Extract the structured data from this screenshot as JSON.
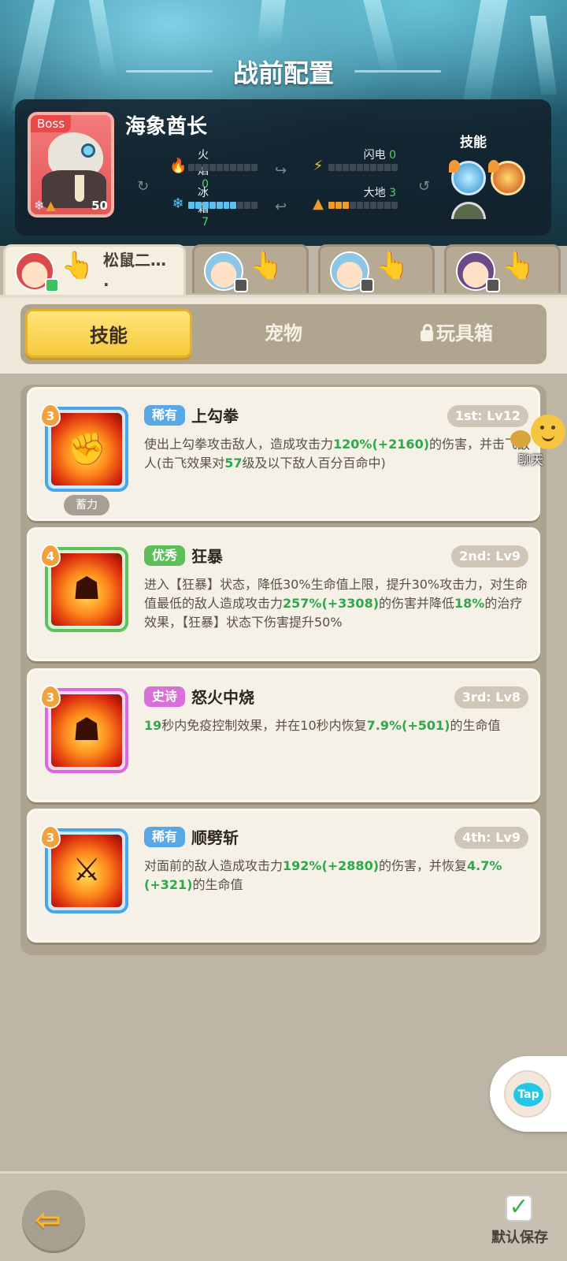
{
  "header": {
    "title": "战前配置"
  },
  "boss": {
    "tag": "Boss",
    "name": "海象酋长",
    "level": "50",
    "skills_label": "技能",
    "elements": [
      {
        "name": "火焰",
        "value": "0",
        "icon": "flame-icon",
        "color": "#ff5a3c",
        "filled": 0
      },
      {
        "name": "闪电",
        "value": "0",
        "icon": "lightning-icon",
        "color": "#f7c22a",
        "filled": 0
      },
      {
        "name": "冰霜",
        "value": "7",
        "icon": "snowflake-icon",
        "color": "#5cc1f0",
        "filled": 7
      },
      {
        "name": "大地",
        "value": "3",
        "icon": "earth-icon",
        "color": "#f09a2a",
        "filled": 3
      }
    ]
  },
  "heroes": [
    {
      "name": "松鼠二…\n.",
      "avatar": "red",
      "active": true
    },
    {
      "name": "",
      "avatar": "blue",
      "active": false
    },
    {
      "name": "",
      "avatar": "blue",
      "active": false
    },
    {
      "name": "",
      "avatar": "purple",
      "active": false
    }
  ],
  "categories": {
    "skills": "技能",
    "pets": "宠物",
    "toybox": "玩具箱"
  },
  "skills": [
    {
      "rarity": "稀有",
      "rarity_color": "#5aa7e6",
      "name": "上勾拳",
      "slot": "1st: Lv12",
      "level": "3",
      "tag": "蓄力",
      "frame": "blue",
      "desc": [
        {
          "t": "使出上勾拳攻击敌人，造成攻击力"
        },
        {
          "t": "120%(+2160)",
          "g": true
        },
        {
          "t": "的伤害，并击飞敌人(击飞效果对"
        },
        {
          "t": "57",
          "g": true
        },
        {
          "t": "级及以下敌人百分百命中)"
        }
      ]
    },
    {
      "rarity": "优秀",
      "rarity_color": "#5cbf5a",
      "name": "狂暴",
      "slot": "2nd: Lv9",
      "level": "4",
      "tag": "",
      "frame": "green",
      "desc": [
        {
          "t": "进入【狂暴】状态，降低30%生命值上限，提升30%攻击力，对生命值最低的敌人造成攻击力"
        },
        {
          "t": "257%(+3308)",
          "g": true
        },
        {
          "t": "的伤害并降低"
        },
        {
          "t": "18%",
          "g": true
        },
        {
          "t": "的治疗效果，【狂暴】状态下伤害提升50%"
        }
      ]
    },
    {
      "rarity": "史诗",
      "rarity_color": "#d96fd8",
      "name": "怒火中烧",
      "slot": "3rd: Lv8",
      "level": "3",
      "tag": "",
      "frame": "purple",
      "desc": [
        {
          "t": "19",
          "g": true
        },
        {
          "t": "秒内免疫控制效果，并在10秒内恢复"
        },
        {
          "t": "7.9%(+501)",
          "g": true
        },
        {
          "t": "的生命值"
        }
      ]
    },
    {
      "rarity": "稀有",
      "rarity_color": "#5aa7e6",
      "name": "顺劈斩",
      "slot": "4th: Lv9",
      "level": "3",
      "tag": "",
      "frame": "blue",
      "desc": [
        {
          "t": "对面前的敌人造成攻击力"
        },
        {
          "t": "192%(+2880)",
          "g": true
        },
        {
          "t": "的伤害，并恢复"
        },
        {
          "t": "4.7%(+321)",
          "g": true
        },
        {
          "t": "的生命值"
        }
      ]
    }
  ],
  "widgets": {
    "chat_label": "聊天",
    "tap_label": "Tap",
    "save_label": "默认保存"
  }
}
